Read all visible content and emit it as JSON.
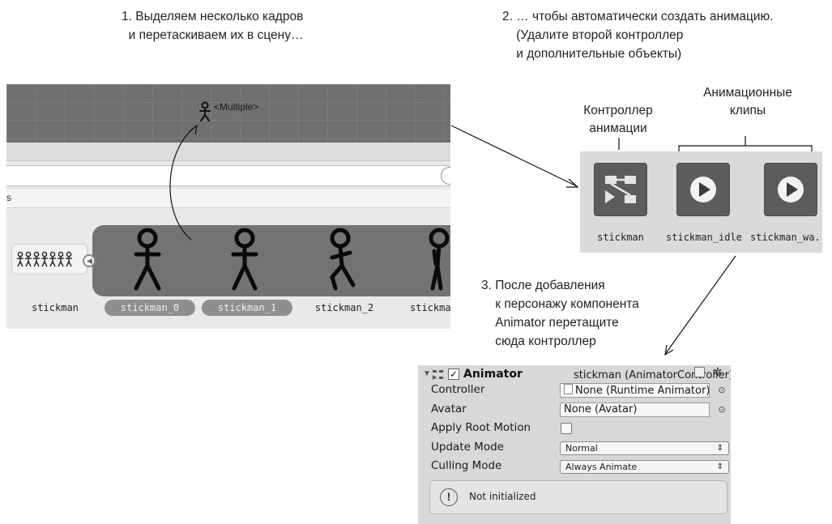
{
  "annotations": {
    "step1": "1. Выделяем несколько кадров\n  и перетаскиваем их в сцену…",
    "step2": "2. … чтобы автоматически создать анимацию.\n    (Удалите второй контроллер\n    и дополнительные объекты)",
    "step3": "3. После добавления\n    к персонажу компонента\n    Animator перетащите\n    сюда контроллер",
    "controller_label": "Контроллер\nанимации",
    "clips_label": "Анимационные\nклипы"
  },
  "scene": {
    "multiple_label": "<Multiple>",
    "breadcrumb_fragment": "s"
  },
  "sprites": {
    "frames": [
      "stickman",
      "stickman_0",
      "stickman_1",
      "stickman_2",
      "stickma"
    ],
    "selected": [
      "stickman_0",
      "stickman_1"
    ]
  },
  "project": {
    "assets": [
      {
        "name": "stickman",
        "kind": "animator-controller-icon"
      },
      {
        "name": "stickman_idle",
        "kind": "animation-clip-icon"
      },
      {
        "name": "stickman_wa...",
        "kind": "animation-clip-icon"
      }
    ]
  },
  "inspector": {
    "component_title": "Animator",
    "component_value": "stickman (AnimatorController)",
    "controller_label": "Controller",
    "controller_value": "None (Runtime Animator)",
    "avatar_label": "Avatar",
    "avatar_value": "None (Avatar)",
    "apply_root_motion_label": "Apply Root Motion",
    "update_mode_label": "Update Mode",
    "update_mode_value": "Normal",
    "culling_mode_label": "Culling Mode",
    "culling_mode_value": "Always Animate",
    "warning": "Not initialized"
  },
  "colors": {
    "scene_grid": "#707070",
    "sprite_strip": "#737373",
    "tile": "#5c5c5c",
    "panel": "#dadada"
  }
}
